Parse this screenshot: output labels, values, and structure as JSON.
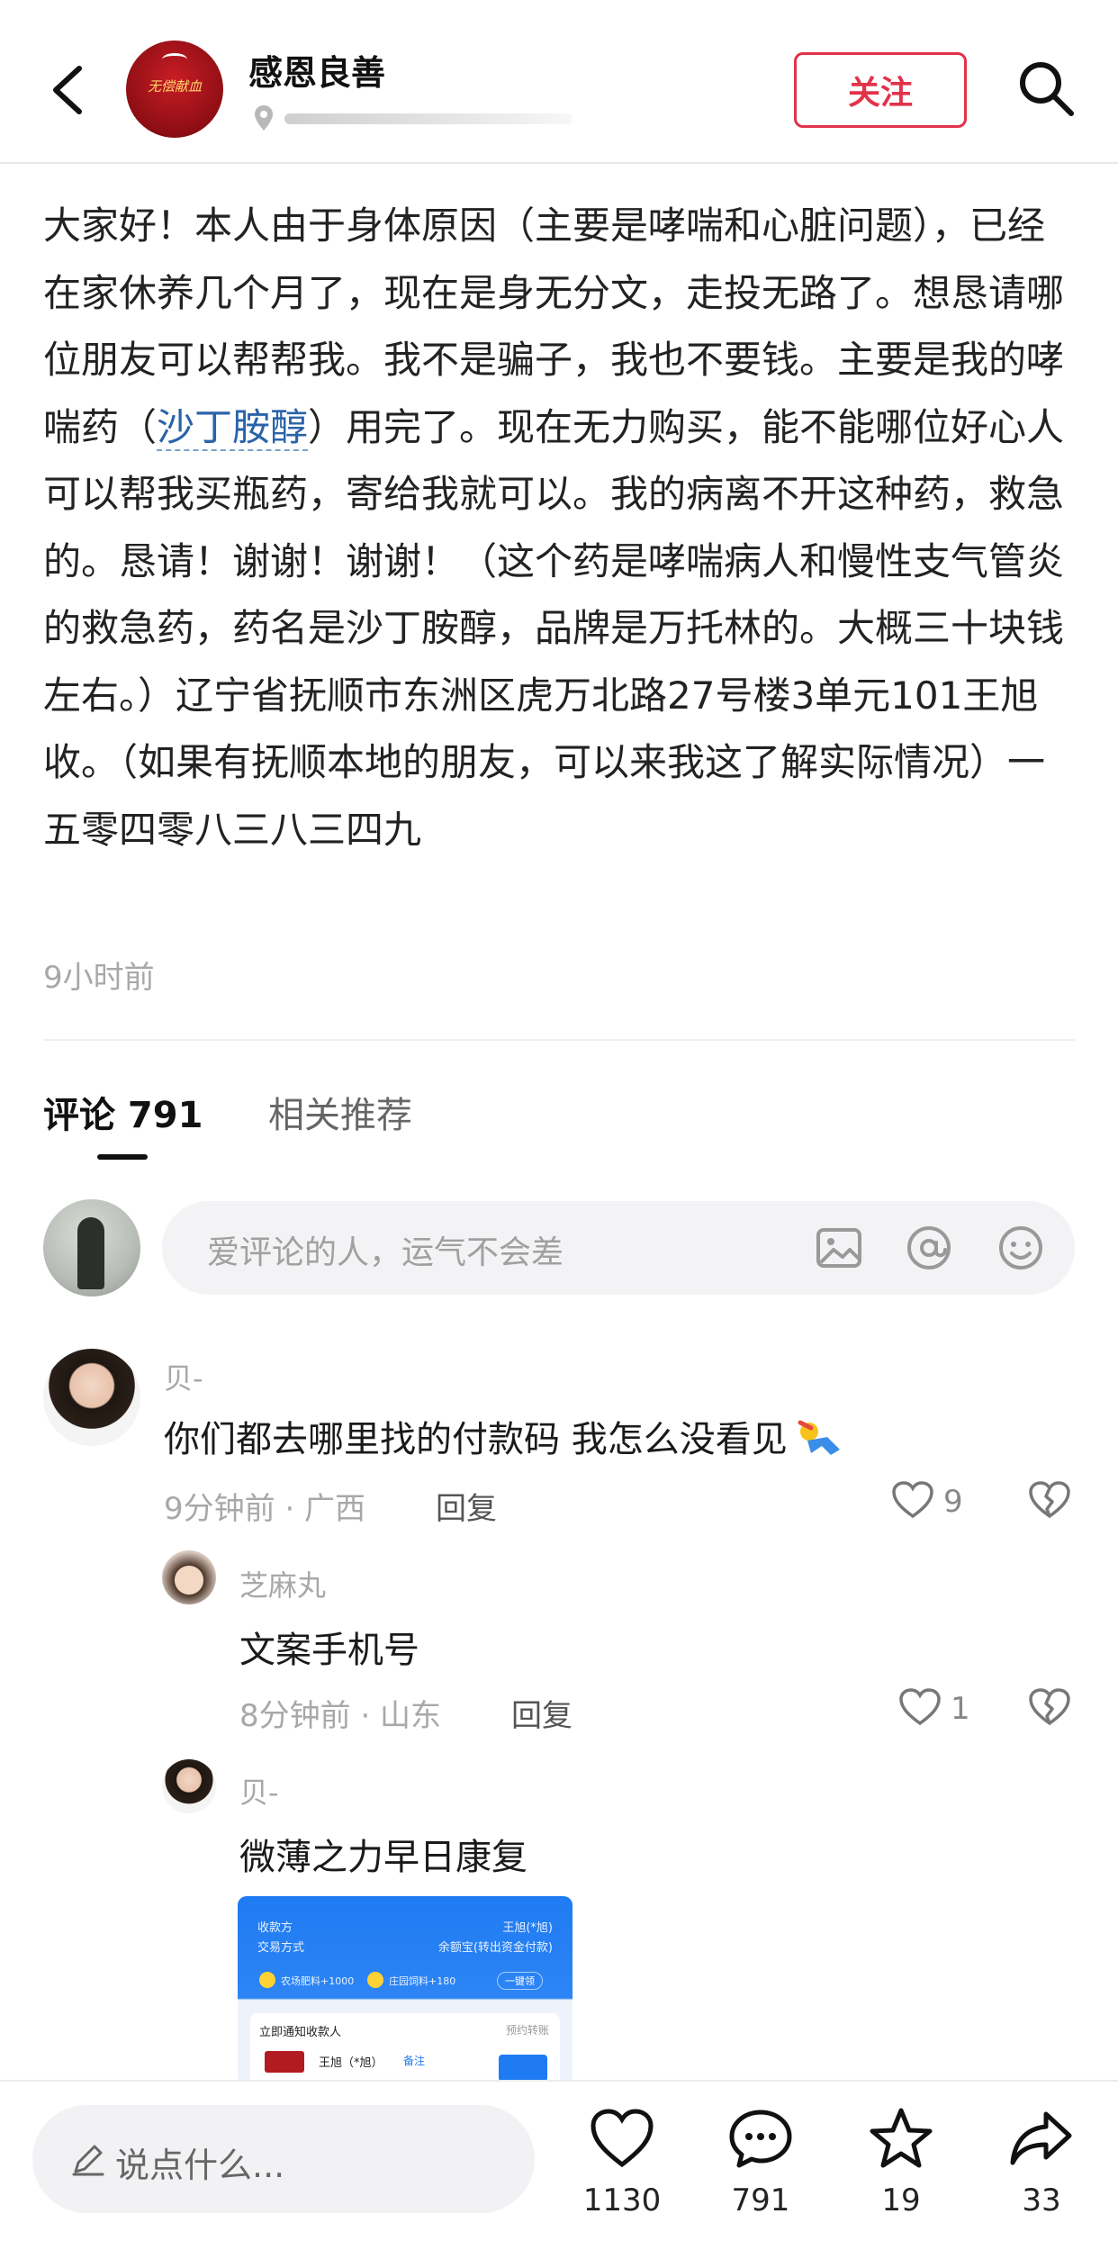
{
  "header": {
    "username": "感恩良善",
    "avatar_seal_text": "无偿献血",
    "follow_label": "关注"
  },
  "post": {
    "text_before_link": "大家好！本人由于身体原因（主要是哮喘和心脏问题），已经在家休养几个月了，现在是身无分文，走投无路了。想恳请哪位朋友可以帮帮我。我不是骗子，我也不要钱。主要是我的哮喘药（",
    "link_text": "沙丁胺醇",
    "text_after_link": "）用完了。现在无力购买，能不能哪位好心人可以帮我买瓶药，寄给我就可以。我的病离不开这种药，救急的。恳请！谢谢！谢谢！（这个药是哮喘病人和慢性支气管炎的救急药，药名是沙丁胺醇，品牌是万托林的。大概三十块钱左右。）辽宁省抚顺市东洲区虎万北路27号楼3单元101王旭收。（如果有抚顺本地的朋友，可以来我这了解实际情况）一五零四零八三八三四九",
    "time": "9小时前"
  },
  "tabs": {
    "comments_label": "评论 791",
    "related_label": "相关推荐"
  },
  "comment_input": {
    "placeholder": "爱评论的人，运气不会差"
  },
  "comments": [
    {
      "name": "贝-",
      "text": "你们都去哪里找的付款码 我怎么没看见",
      "meta": "9分钟前 · 广西",
      "reply_label": "回复",
      "likes": "9"
    },
    {
      "name": "芝麻丸",
      "text": "文案手机号",
      "meta": "8分钟前 · 山东",
      "reply_label": "回复",
      "likes": "1"
    },
    {
      "name": "贝-",
      "text": "微薄之力早日康复"
    }
  ],
  "payment_screenshot": {
    "payee_label": "收款方",
    "payee_value": "王旭(*旭)",
    "method_label": "交易方式",
    "method_value": "余额宝(转出资金付款)",
    "reward1": "农场肥料+1000",
    "reward2": "庄园饲料+180",
    "one_click": "一键领",
    "notify": "立即通知收款人",
    "transfer": "预约转账",
    "recipient": "王旭（*旭）",
    "note": "备注"
  },
  "bottom_bar": {
    "say_placeholder": "说点什么...",
    "likes": "1130",
    "comments": "791",
    "stars": "19",
    "shares": "33"
  },
  "colors": {
    "accent": "#e1334a",
    "link": "#2a63a8",
    "muted": "#a8a8a8"
  }
}
